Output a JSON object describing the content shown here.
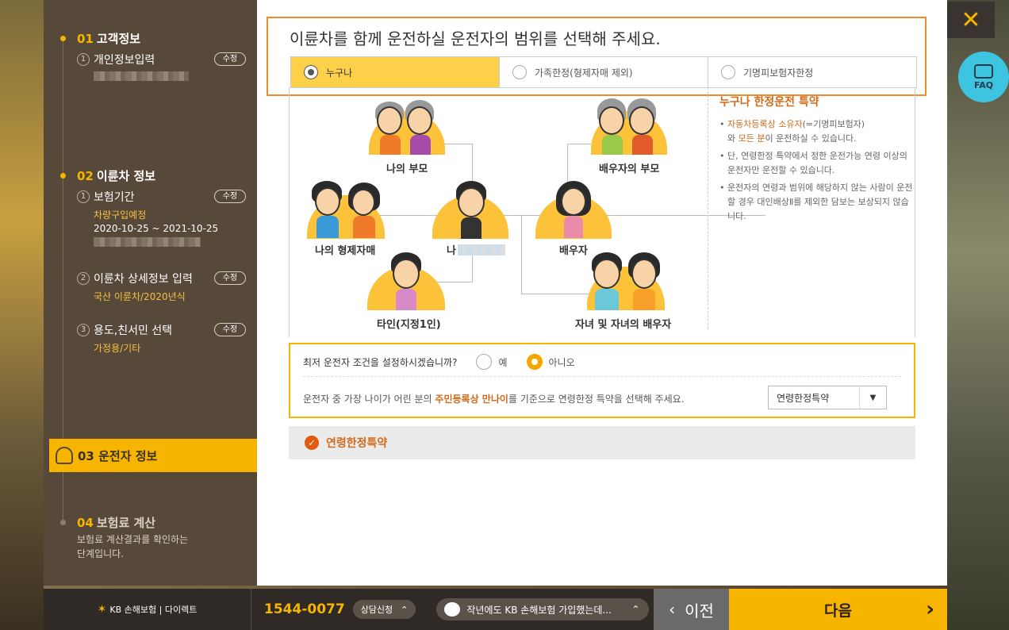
{
  "sidebar": {
    "step1": {
      "num": "01",
      "title": "고객정보",
      "sub1": {
        "idx": "1",
        "label": "개인정보입력",
        "edit": "수정"
      }
    },
    "step2": {
      "num": "02",
      "title": "이륜차 정보",
      "sub1": {
        "idx": "1",
        "label": "보험기간",
        "edit": "수정",
        "detail1": "차량구입예정",
        "detail2": "2020-10-25 ~ 2021-10-25"
      },
      "sub2": {
        "idx": "2",
        "label": "이륜차 상세정보 입력",
        "edit": "수정",
        "detail": "국산 이륜차/2020년식"
      },
      "sub3": {
        "idx": "3",
        "label": "용도,친서민 선택",
        "edit": "수정",
        "detail": "가정용/기타"
      }
    },
    "step3": {
      "num": "03",
      "title": "운전자 정보"
    },
    "step4": {
      "num": "04",
      "title": "보험료 계산",
      "desc1": "보험료 계산결과를 확인하는",
      "desc2": "단계입니다."
    }
  },
  "question": {
    "title": "이륜차를 함께 운전하실 운전자의 범위를 선택해 주세요.",
    "options": [
      "누구나",
      "가족한정(형제자매 제외)",
      "기명피보험자한정"
    ],
    "selected": "누구나"
  },
  "family": {
    "parents": "나의 부모",
    "spouse_parents": "배우자의 부모",
    "siblings": "나의 형제자매",
    "me": "나",
    "spouse": "배우자",
    "other": "타인(지정1인)",
    "children": "자녀 및 자녀의 배우자"
  },
  "info": {
    "title": "누구나 한정운전 특약",
    "item1_hl1": "자동차등록상 소유자",
    "item1_a": "(=기명피보험자)",
    "item1_b": "와 ",
    "item1_hl2": "모든 분",
    "item1_c": "이 운전하실 수 있습니다.",
    "item2": "단, 연령한정 특약에서 정한 운전가능 연령 이상의 운전자만 운전할 수 있습니다.",
    "item3": "운전자의 연령과 범위에 해당하지 않는 사람이 운전할 경우 대인배상Ⅱ를 제외한 담보는 보상되지 않습니다."
  },
  "condition": {
    "question": "최저 운전자 조건을 설정하시겠습니까?",
    "yes": "예",
    "no": "아니오",
    "selected": "아니오",
    "desc_a": "운전자 중 가장 나이가 어린 분의 ",
    "desc_hl": "주민등록상 만나이",
    "desc_b": "를 기준으로 연령한정 특약을 선택해 주세요.",
    "select_value": "연령한정특약"
  },
  "special": {
    "label": "연령한정특약"
  },
  "faq": {
    "label": "FAQ"
  },
  "footer": {
    "logo": "KB 손해보험 | 다이렉트",
    "phone": "1544-0077",
    "consult": "상담신청",
    "chat": "작년에도 KB 손해보험 가입했는데...",
    "prev": "이전",
    "next": "다음"
  },
  "colors": {
    "accent": "#f7b500",
    "sidebar": "#56493a",
    "highlight": "#d26a1a",
    "question_border": "#f08a2a"
  }
}
